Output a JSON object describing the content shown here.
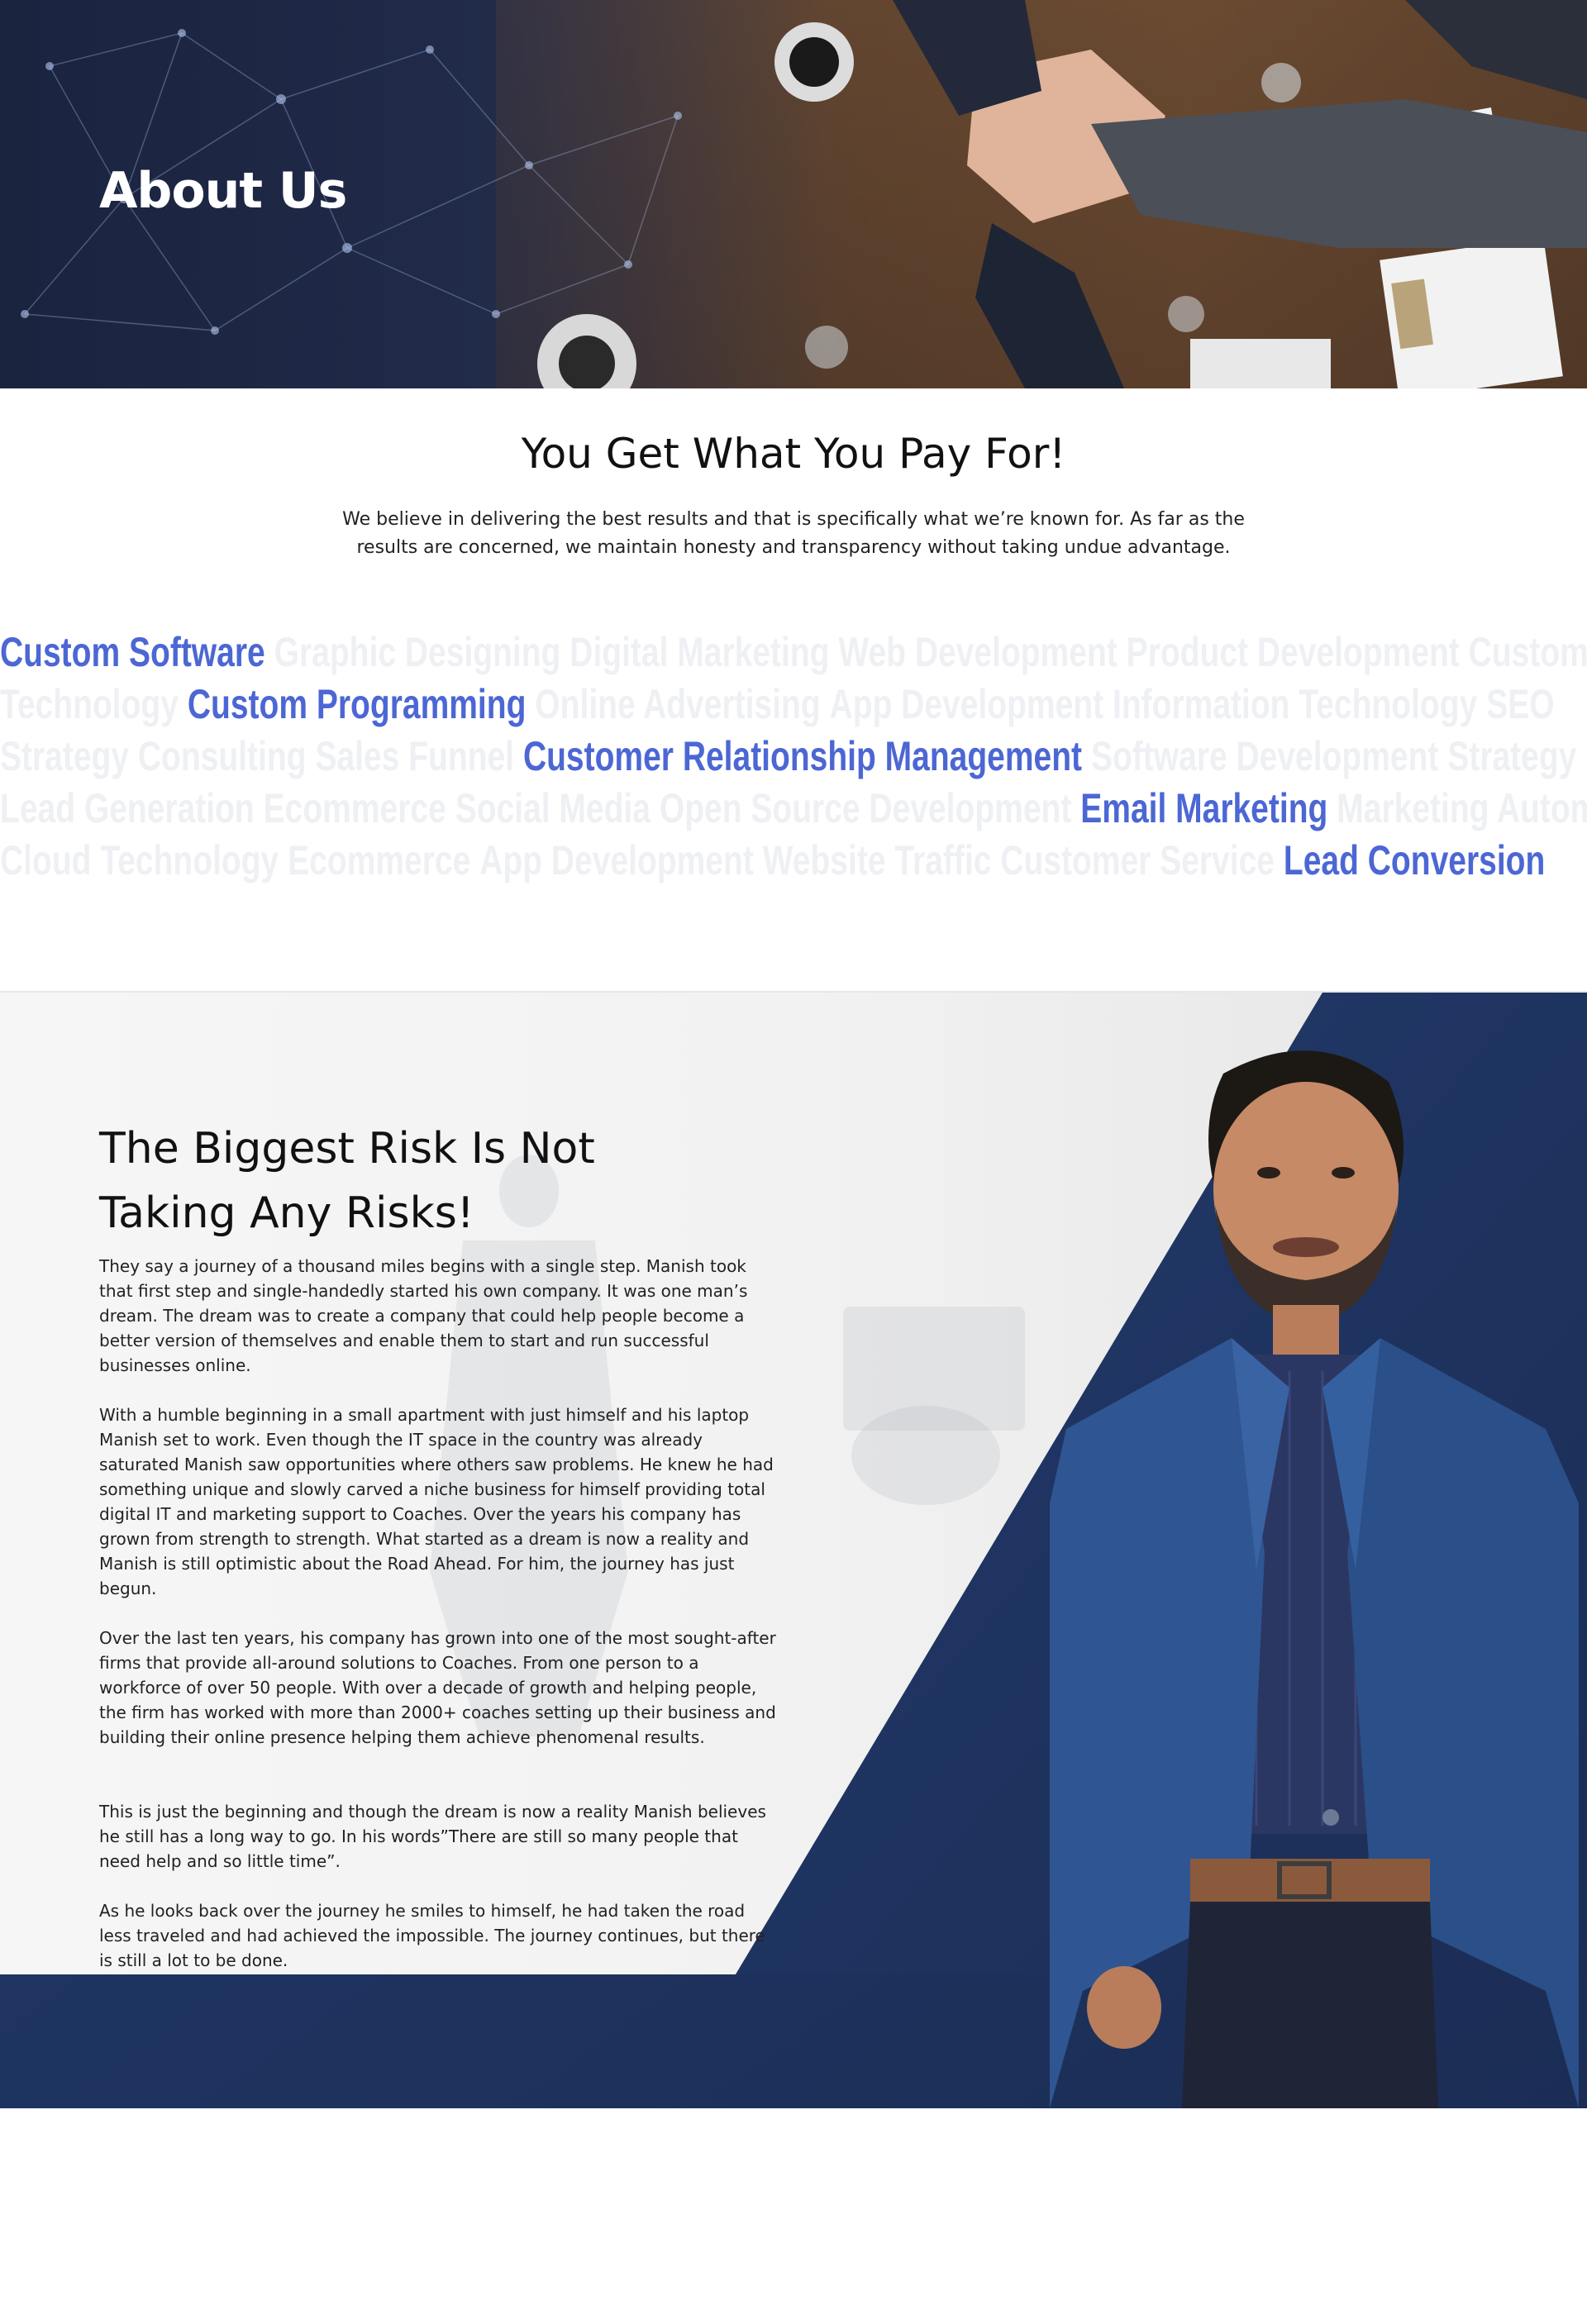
{
  "hero": {
    "title": "About Us"
  },
  "intro": {
    "title": "You Get What You Pay For!",
    "text": "We believe in delivering the best results and that is specifically what we’re known for. As far as the results are concerned, we maintain honesty and transparency without taking undue advantage."
  },
  "word_cloud": {
    "rows": [
      {
        "words": [
          {
            "text": "Custom Software",
            "hl": true
          },
          {
            "text": "Graphic Designing"
          },
          {
            "text": "Digital Marketing"
          },
          {
            "text": "Web Development"
          },
          {
            "text": "Product Development"
          },
          {
            "text": "Custom Software"
          }
        ]
      },
      {
        "words": [
          {
            "text": "Technology"
          },
          {
            "text": "Custom Programming",
            "hl": true
          },
          {
            "text": "Online Advertising"
          },
          {
            "text": "App Development"
          },
          {
            "text": "Information Technology"
          },
          {
            "text": "SEO"
          }
        ]
      },
      {
        "words": [
          {
            "text": "Strategy Consulting"
          },
          {
            "text": "Sales Funnel"
          },
          {
            "text": "Customer Relationship Management",
            "hl": true
          },
          {
            "text": "Software Development"
          },
          {
            "text": "Strategy"
          }
        ]
      },
      {
        "words": [
          {
            "text": "Lead Generation"
          },
          {
            "text": "Ecommerce"
          },
          {
            "text": "Social Media"
          },
          {
            "text": "Open Source Development"
          },
          {
            "text": "Email Marketing",
            "hl": true
          },
          {
            "text": "Marketing Automation"
          }
        ]
      },
      {
        "words": [
          {
            "text": "Cloud Technology"
          },
          {
            "text": "Ecommerce"
          },
          {
            "text": "App Development"
          },
          {
            "text": "Website Traffic"
          },
          {
            "text": "Customer Service"
          },
          {
            "text": "Lead Conversion",
            "hl": true
          }
        ]
      }
    ],
    "highlight_color": "#4c67d4",
    "faded_color": "#eef0f3"
  },
  "founder": {
    "title_line1": "The Biggest Risk Is Not",
    "title_line2": "Taking Any Risks!",
    "paragraphs": [
      "They say a journey of a thousand miles begins with a single step. Manish took that first step and single-handedly started his own company. It was one man’s dream. The dream was to create a company that could help people become a better version of themselves and enable them to start and run successful businesses online.",
      "With a humble beginning in a small apartment with just himself and his laptop Manish set to work. Even though the IT space in the country was already saturated Manish saw opportunities where others saw problems. He knew he had something unique and slowly carved a niche business for himself providing total digital IT and marketing support to Coaches. Over the years his company has grown from strength to strength. What started as a dream is now a reality and Manish is still optimistic about the Road Ahead. For him, the journey has just begun.",
      "Over the last ten years, his company has grown into one of the most sought-after firms that provide all-around solutions to Coaches. From one person to a workforce of over 50 people. With over a decade of growth and helping people, the firm has worked with more than 2000+ coaches setting up their business and building their online presence helping them achieve phenomenal results.",
      "This is just the beginning and though the dream is now a reality Manish believes he still has a long way to go. In his words”There are still so many people that need help and so little time”.",
      "As he looks back over the journey he smiles to himself, he had taken the road less traveled and had achieved the impossible. The journey continues, but there is still a lot to be done."
    ],
    "navy_color": "#1f3360"
  }
}
